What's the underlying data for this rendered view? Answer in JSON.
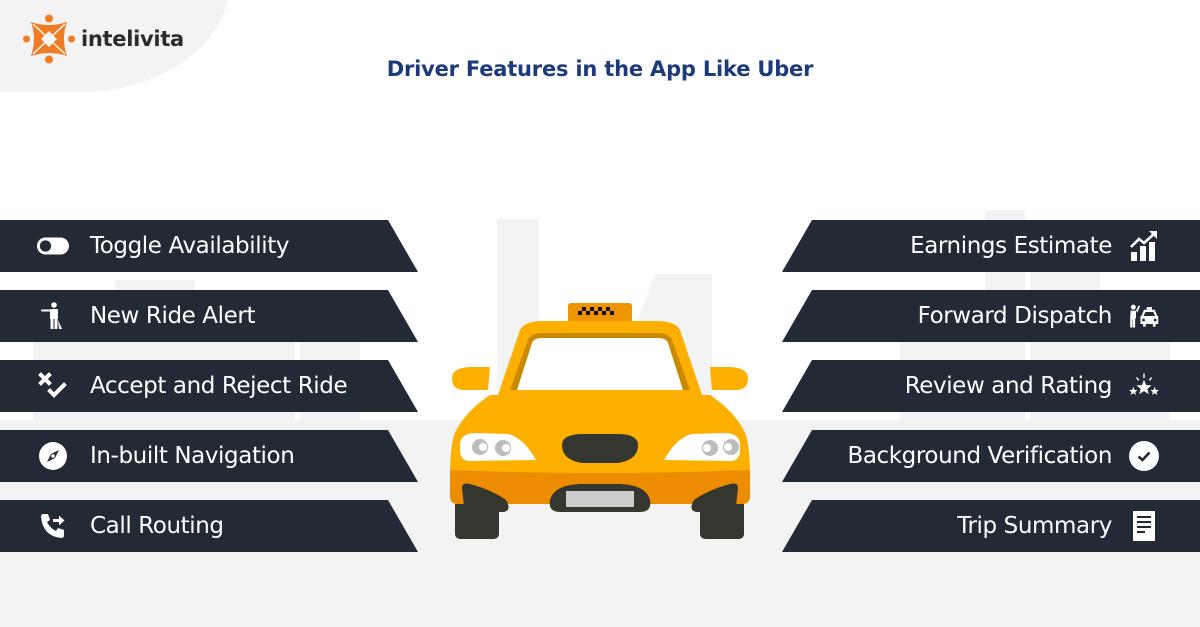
{
  "brand": {
    "name": "intelivita",
    "logo_icon": "intelivita-logo-icon",
    "accent_color": "#f07c23"
  },
  "title": "Driver Features in the App Like Uber",
  "colors": {
    "title": "#1d3a7a",
    "banner_bg": "#222a35",
    "banner_text": "#ffffff",
    "taxi_yellow": "#fdb000",
    "taxi_orange": "#ee8c00",
    "background_gray": "#f3f3f3"
  },
  "left_features": [
    {
      "label": "Toggle Availability",
      "icon": "toggle-icon"
    },
    {
      "label": "New Ride Alert",
      "icon": "person-hailing-icon"
    },
    {
      "label": "Accept and Reject Ride",
      "icon": "accept-reject-icon"
    },
    {
      "label": "In-built Navigation",
      "icon": "compass-icon"
    },
    {
      "label": "Call Routing",
      "icon": "call-forward-icon"
    }
  ],
  "right_features": [
    {
      "label": "Earnings Estimate",
      "icon": "growth-chart-icon"
    },
    {
      "label": "Forward Dispatch",
      "icon": "person-taxi-icon"
    },
    {
      "label": "Review and Rating",
      "icon": "stars-icon"
    },
    {
      "label": "Background Verification",
      "icon": "check-circle-icon"
    },
    {
      "label": "Trip Summary",
      "icon": "document-icon"
    }
  ],
  "illustration": {
    "subject": "taxi-car-front",
    "description": "Yellow taxi front view with checkered roof sign"
  }
}
